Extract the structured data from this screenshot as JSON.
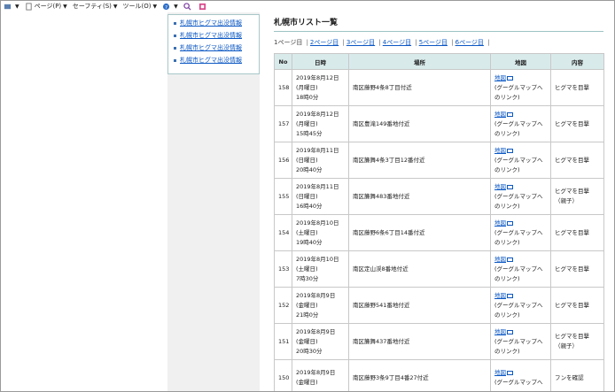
{
  "toolbar": {
    "items": [
      {
        "label": "",
        "icon": "home-icon"
      },
      {
        "label": "ページ(P)",
        "icon": "page-icon"
      },
      {
        "label": "セーフティ(S)",
        "icon": ""
      },
      {
        "label": "ツール(O)",
        "icon": ""
      },
      {
        "label": "",
        "icon": "help-icon"
      }
    ]
  },
  "sidebar": {
    "links": [
      "札幌市ヒグマ出没情報",
      "札幌市ヒグマ出没情報",
      "札幌市ヒグマ出没情報",
      "札幌市ヒグマ出没情報"
    ]
  },
  "main": {
    "title": "札幌市リスト一覧",
    "pager": {
      "current": "1ページ目",
      "links": [
        "2ページ目",
        "3ページ目",
        "4ページ目",
        "5ページ目",
        "6ページ目"
      ]
    },
    "table": {
      "headers": [
        "No",
        "日時",
        "場所",
        "地図",
        "内容"
      ],
      "rows": [
        {
          "no": "158",
          "date": "2019年8月12日",
          "day": "(月曜日)",
          "time": "18時0分",
          "place": "南区藤野4条8丁目付近",
          "map": "地図",
          "map_note1": "(グーグルマップへ",
          "map_note2": "のリンク)",
          "content1": "ヒグマを目撃",
          "content2": ""
        },
        {
          "no": "157",
          "date": "2019年8月12日",
          "day": "(月曜日)",
          "time": "15時45分",
          "place": "南区豊滝149番地付近",
          "map": "地図",
          "map_note1": "(グーグルマップへ",
          "map_note2": "のリンク)",
          "content1": "ヒグマを目撃",
          "content2": ""
        },
        {
          "no": "156",
          "date": "2019年8月11日",
          "day": "(日曜日)",
          "time": "20時40分",
          "place": "南区簾舞4条3丁目12番付近",
          "map": "地図",
          "map_note1": "(グーグルマップへ",
          "map_note2": "のリンク)",
          "content1": "ヒグマを目撃",
          "content2": ""
        },
        {
          "no": "155",
          "date": "2019年8月11日",
          "day": "(日曜日)",
          "time": "16時40分",
          "place": "南区簾舞483番地付近",
          "map": "地図",
          "map_note1": "(グーグルマップへ",
          "map_note2": "のリンク)",
          "content1": "ヒグマを目撃",
          "content2": "（親子）"
        },
        {
          "no": "154",
          "date": "2019年8月10日",
          "day": "(土曜日)",
          "time": "19時40分",
          "place": "南区藤野6条6丁目14番付近",
          "map": "地図",
          "map_note1": "(グーグルマップへ",
          "map_note2": "のリンク)",
          "content1": "ヒグマを目撃",
          "content2": ""
        },
        {
          "no": "153",
          "date": "2019年8月10日",
          "day": "(土曜日)",
          "time": "7時30分",
          "place": "南区定山渓8番地付近",
          "map": "地図",
          "map_note1": "(グーグルマップへ",
          "map_note2": "のリンク)",
          "content1": "ヒグマを目撃",
          "content2": ""
        },
        {
          "no": "152",
          "date": "2019年8月9日",
          "day": "(金曜日)",
          "time": "21時0分",
          "place": "南区藤野541番地付近",
          "map": "地図",
          "map_note1": "(グーグルマップへ",
          "map_note2": "のリンク)",
          "content1": "ヒグマを目撃",
          "content2": ""
        },
        {
          "no": "151",
          "date": "2019年8月9日",
          "day": "(金曜日)",
          "time": "20時30分",
          "place": "南区簾舞437番地付近",
          "map": "地図",
          "map_note1": "(グーグルマップへ",
          "map_note2": "のリンク)",
          "content1": "ヒグマを目撃",
          "content2": "（親子）"
        },
        {
          "no": "150",
          "date": "2019年8月9日",
          "day": "(金曜日)",
          "time": "",
          "place": "南区藤野3条9丁目4番27付近",
          "map": "地図",
          "map_note1": "(グーグルマップへ",
          "map_note2": "",
          "content1": "フンを確認",
          "content2": ""
        }
      ]
    }
  }
}
